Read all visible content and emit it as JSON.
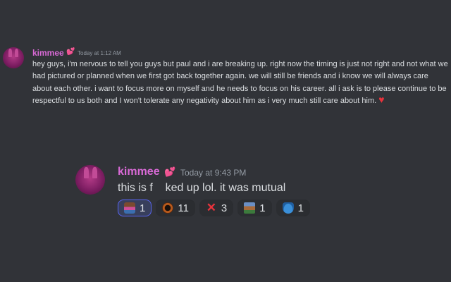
{
  "message1": {
    "username": "kimmee",
    "timestamp": "Today at 1:12 AM",
    "text": "hey guys, i'm nervous to tell you guys but paul and i are breaking up. right now the timing is just not right and not what we had pictured or planned when we first got back together again. we will still be friends and i know we will always care about each other. i want to focus more on myself and he needs to focus on his career. all i ask is to please continue to be respectful to us both and I won't tolerate any negativity about him as i very much still care about him."
  },
  "message2": {
    "username": "kimmee",
    "timestamp": "Today at 9:43 PM",
    "text": "this is f    ked up lol. it was mutual"
  },
  "reactions": [
    {
      "icon": "cat-emoji-icon",
      "count": "1",
      "active": true
    },
    {
      "icon": "ring-emoji-icon",
      "count": "11",
      "active": false
    },
    {
      "icon": "cross-mark-icon",
      "count": "3",
      "active": false
    },
    {
      "icon": "house-emoji-icon",
      "count": "1",
      "active": false
    },
    {
      "icon": "blue-pot-emoji-icon",
      "count": "1",
      "active": false
    }
  ],
  "colors": {
    "background": "#313338",
    "username": "#d96ad6",
    "heart": "#e8333c",
    "active_reaction": "#5865f2"
  }
}
